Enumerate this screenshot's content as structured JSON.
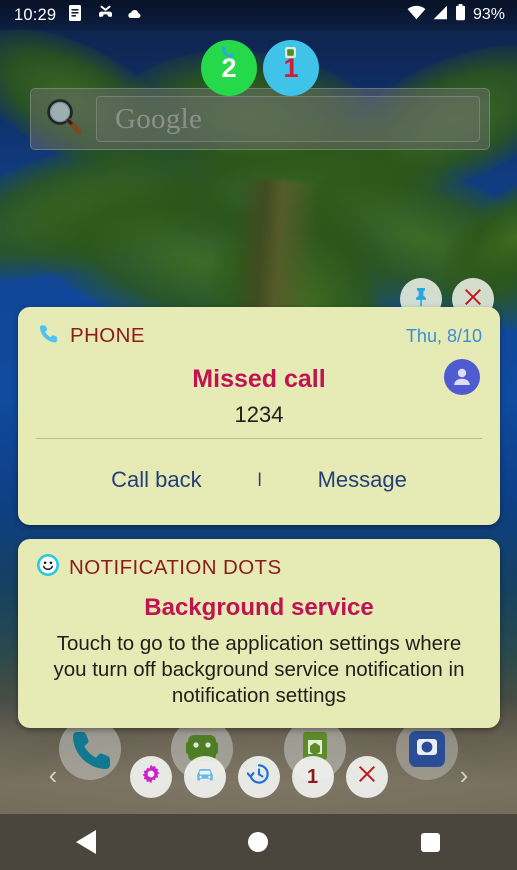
{
  "status_bar": {
    "clock": "10:29",
    "left_icons": [
      "note-icon",
      "missed-call-icon",
      "cloud-download-icon"
    ],
    "right_icons": [
      "wifi-icon",
      "signal-icon",
      "battery-icon"
    ],
    "battery_percent": "93%"
  },
  "badges": [
    {
      "name": "badge-green",
      "count": "2",
      "bg": "#26d94a",
      "fg": "#ffffff",
      "mini_icon": "phone-icon"
    },
    {
      "name": "badge-cyan",
      "count": "1",
      "bg": "#3fc3e8",
      "fg": "#d3193a",
      "mini_icon": "app-icon"
    }
  ],
  "search_widget": {
    "icon": "magnifier-icon",
    "placeholder": "Google"
  },
  "overlay_controls": [
    {
      "name": "pin-button",
      "icon": "pushpin-icon",
      "color": "#29a8df"
    },
    {
      "name": "close-button",
      "icon": "close-x-icon",
      "color": "#c2171d"
    }
  ],
  "notifications": [
    {
      "app_name": "PHONE",
      "app_icon": "phone-handset-icon",
      "time": "Thu, 8/10",
      "title": "Missed call",
      "subtitle": "1234",
      "avatar_icon": "person-avatar-icon",
      "actions": [
        {
          "label": "Call back"
        },
        {
          "label": "Message"
        }
      ],
      "action_separator": "l"
    },
    {
      "app_name": "NOTIFICATION DOTS",
      "app_icon": "smiley-face-icon",
      "title": "Background service",
      "body": "Touch to go to the application settings where you turn off background service notification in notification settings"
    }
  ],
  "app_row": [
    {
      "name": "app-phone",
      "icon": "phone-app-icon"
    },
    {
      "name": "app-messages",
      "icon": "messages-app-icon"
    },
    {
      "name": "app-play-store",
      "icon": "play-store-app-icon"
    },
    {
      "name": "app-camera",
      "icon": "camera-app-icon"
    }
  ],
  "dock": {
    "left_arrow": "‹",
    "right_arrow": "›",
    "buttons": [
      {
        "name": "settings-button",
        "icon": "gear-icon",
        "color": "#cf20cf"
      },
      {
        "name": "car-button",
        "icon": "car-icon",
        "color": "#66b8ec"
      },
      {
        "name": "history-button",
        "icon": "history-clock-icon",
        "color": "#1f72d8"
      },
      {
        "name": "count-button",
        "icon": "count-label",
        "label": "1",
        "color": "#8c1b1b"
      },
      {
        "name": "dismiss-button",
        "icon": "close-x-icon",
        "color": "#c2171d"
      }
    ]
  },
  "navbar": [
    {
      "name": "nav-back-button",
      "icon": "back-triangle-icon"
    },
    {
      "name": "nav-home-button",
      "icon": "home-circle-icon"
    },
    {
      "name": "nav-recents-button",
      "icon": "recents-square-icon"
    }
  ],
  "colors": {
    "card_bg": "#e6eab4",
    "app_name": "#8c1b1b",
    "title": "#c01351",
    "time": "#3b8fd6",
    "action": "#243f7a"
  }
}
